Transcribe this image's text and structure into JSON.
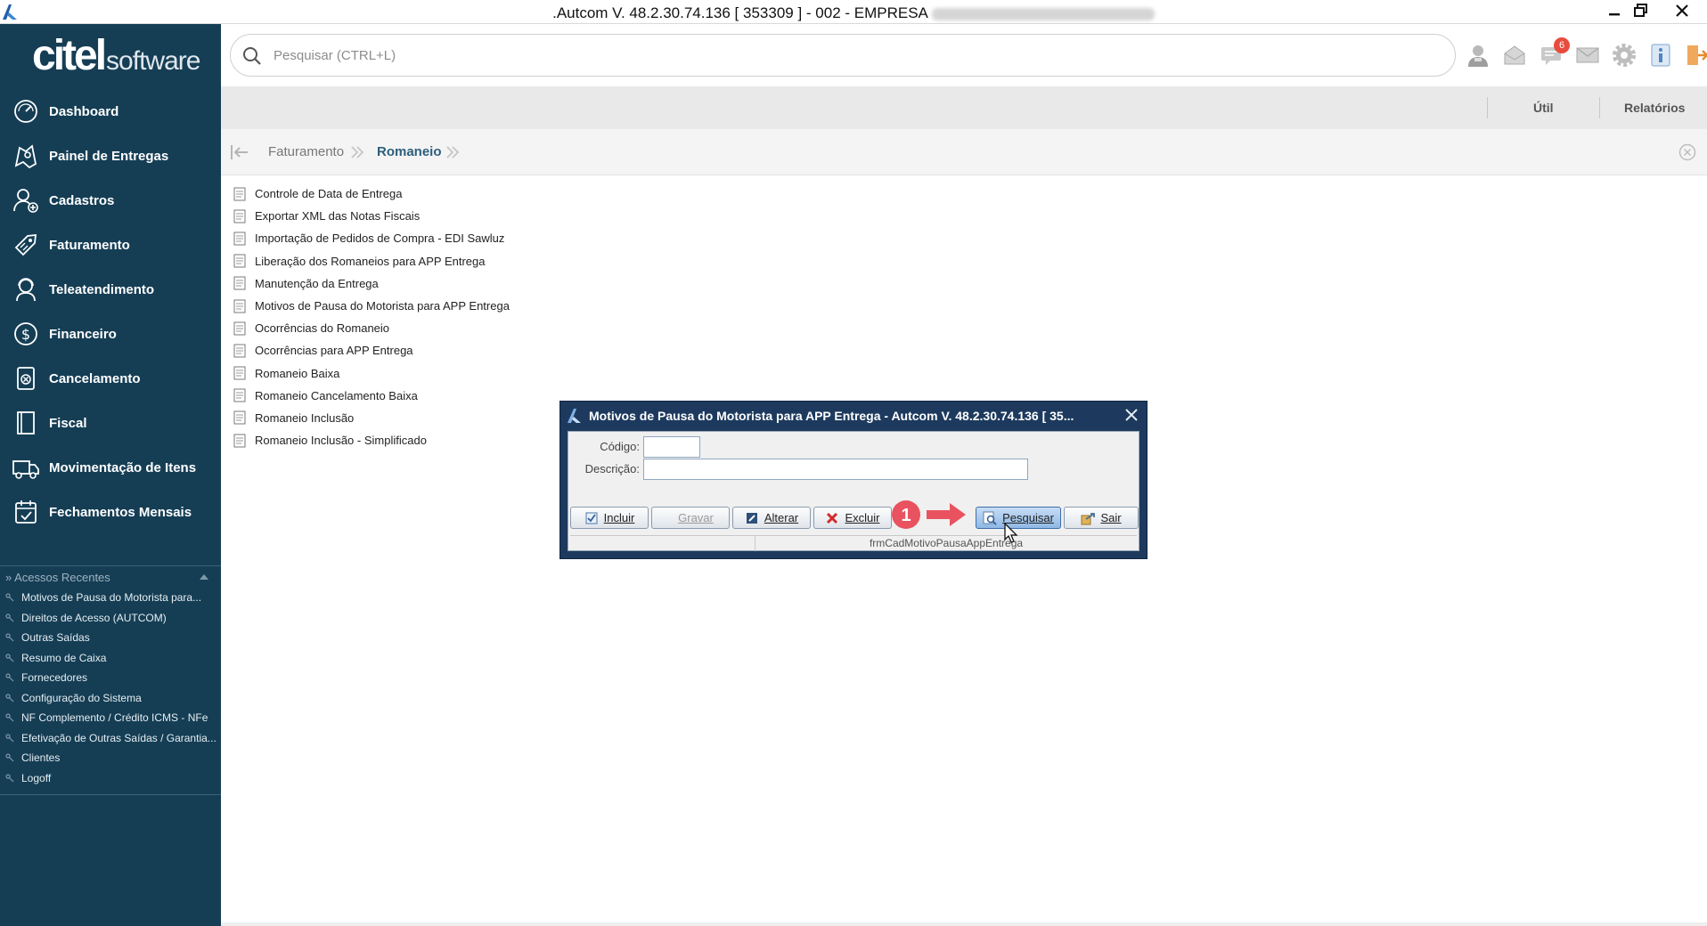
{
  "window": {
    "title": ".Autcom V. 48.2.30.74.136 [ 353309 ] - 002 - EMPRESA"
  },
  "brand": {
    "part1": "citel",
    "part2": "software"
  },
  "nav": [
    {
      "label": "Dashboard",
      "icon": "dashboard-icon"
    },
    {
      "label": "Painel de Entregas",
      "icon": "delivery-map-icon"
    },
    {
      "label": "Cadastros",
      "icon": "user-add-icon"
    },
    {
      "label": "Faturamento",
      "icon": "price-tag-icon"
    },
    {
      "label": "Teleatendimento",
      "icon": "headset-icon"
    },
    {
      "label": "Financeiro",
      "icon": "dollar-icon"
    },
    {
      "label": "Cancelamento",
      "icon": "cancel-document-icon"
    },
    {
      "label": "Fiscal",
      "icon": "book-icon"
    },
    {
      "label": "Movimentação de Itens",
      "icon": "truck-icon"
    },
    {
      "label": "Fechamentos Mensais",
      "icon": "calendar-check-icon"
    }
  ],
  "recent": {
    "title": "» Acessos Recentes",
    "items": [
      "Motivos de Pausa do Motorista para...",
      "Direitos de Acesso (AUTCOM)",
      "Outras Saídas",
      "Resumo de Caixa",
      "Fornecedores",
      "Configuração do Sistema",
      "NF Complemento / Crédito ICMS - NFe",
      "Efetivação de Outras Saídas / Garantia...",
      "Clientes",
      "Logoff"
    ]
  },
  "search": {
    "placeholder": "Pesquisar (CTRL+L)"
  },
  "notifications": {
    "badge": "6"
  },
  "menubar": {
    "util": "Útil",
    "reports": "Relatórios"
  },
  "breadcrumb": {
    "level1": "Faturamento",
    "level2": "Romaneio"
  },
  "list": [
    "Controle de Data de Entrega",
    "Exportar XML das Notas Fiscais",
    "Importação de Pedidos de Compra - EDI Sawluz",
    "Liberação dos Romaneios para APP Entrega",
    "Manutenção da Entrega",
    "Motivos de Pausa do Motorista para APP Entrega",
    "Ocorrências do Romaneio",
    "Ocorrências para APP Entrega",
    "Romaneio Baixa",
    "Romaneio Cancelamento Baixa",
    "Romaneio Inclusão",
    "Romaneio Inclusão - Simplificado"
  ],
  "dialog": {
    "title": "Motivos de Pausa do Motorista para APP Entrega   -   Autcom V. 48.2.30.74.136 [ 35...",
    "codigo_label": "Código:",
    "codigo_value": "",
    "descricao_label": "Descrição:",
    "descricao_value": "",
    "buttons": {
      "incluir": "Incluir",
      "gravar": "Gravar",
      "alterar": "Alterar",
      "excluir": "Excluir",
      "pesquisar": "Pesquisar",
      "sair": "Sair"
    },
    "status_form": "frmCadMotivoPausaAppEntrega"
  },
  "annotation": {
    "step": "1"
  },
  "colors": {
    "sidebar": "#153e55",
    "dialog_frame": "#1d3a5e",
    "annotation": "#e8535f",
    "breadcrumb_active": "#2d5e7c"
  }
}
